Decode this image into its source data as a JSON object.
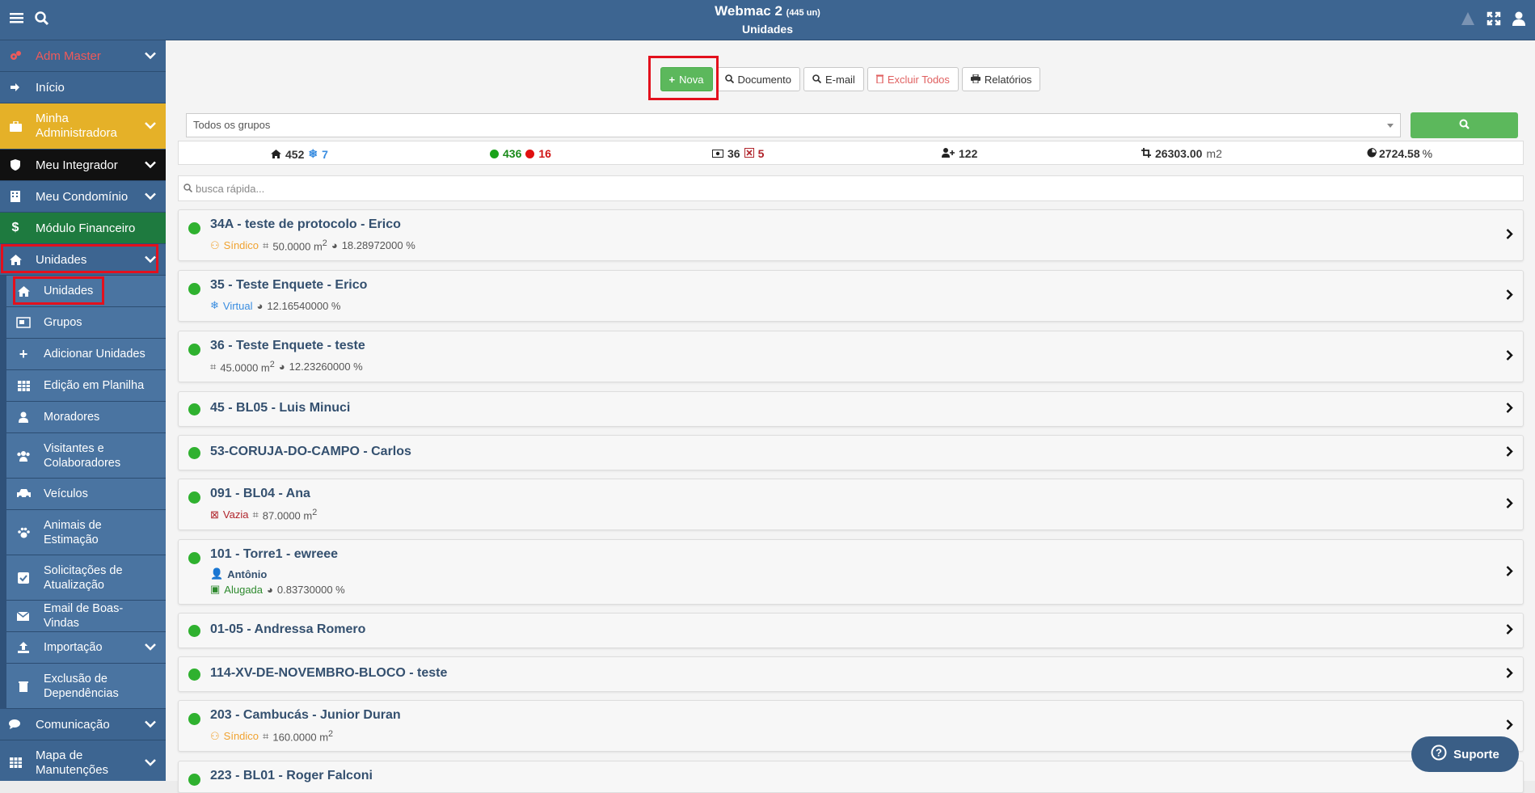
{
  "header": {
    "app_title": "Webmac 2",
    "count": "(445 un)",
    "subtitle": "Unidades",
    "menu_icon": "hamburger-icon",
    "search_icon": "search-icon"
  },
  "sidebar": {
    "admin": "Adm Master",
    "inicio": "Início",
    "minha": "Minha Administradora",
    "integrador": "Meu Integrador",
    "condominio": "Meu Condomínio",
    "financeiro": "Módulo Financeiro",
    "unidades": "Unidades",
    "sub": [
      "Unidades",
      "Grupos",
      "Adicionar Unidades",
      "Edição em Planilha",
      "Moradores",
      "Visitantes e Colaboradores",
      "Veículos",
      "Animais de Estimação",
      "Solicitações de Atualização",
      "Email de Boas-Vindas",
      "Importação",
      "Exclusão de Dependências"
    ],
    "comunicacao": "Comunicação",
    "mapa": "Mapa de Manutenções"
  },
  "toolbar": {
    "nova": "Nova",
    "documento": "Documento",
    "email": "E-mail",
    "excluir": "Excluir Todos",
    "relatorios": "Relatórios"
  },
  "filter": {
    "group_select": "Todos os grupos",
    "quick_placeholder": "busca rápida..."
  },
  "stats": {
    "total": "452",
    "virtual": "7",
    "active": "436",
    "inactive": "16",
    "vacant_a": "36",
    "vacant_b": "5",
    "residents": "122",
    "area": "26303.00",
    "area_unit": "m2",
    "fraction": "2724.58",
    "fraction_unit": "%"
  },
  "units": [
    {
      "name": "34A - teste de protocolo - Erico",
      "role": "Síndico",
      "area": "50.0000 m",
      "sup": "2",
      "fraction": "18.28972000 %"
    },
    {
      "name": "35 - Teste Enquete - Erico",
      "tag": "Virtual",
      "fraction": "12.16540000 %"
    },
    {
      "name": "36 - Teste Enquete - teste",
      "area": "45.0000 m",
      "sup": "2",
      "fraction": "12.23260000 %"
    },
    {
      "name": "45 - BL05 - Luis Minuci"
    },
    {
      "name": "53-CORUJA-DO-CAMPO - Carlos"
    },
    {
      "name": "091 - BL04 - Ana",
      "tag": "Vazia",
      "area": "87.0000 m",
      "sup": "2"
    },
    {
      "name": "101 - Torre1 - ewreee",
      "resident": "Antônio",
      "tag": "Alugada",
      "fraction": "0.83730000 %"
    },
    {
      "name": "01-05 - Andressa Romero"
    },
    {
      "name": "114-XV-DE-NOVEMBRO-BLOCO - teste"
    },
    {
      "name": "203 - Cambucás - Junior Duran",
      "role": "Síndico",
      "area": "160.0000 m",
      "sup": "2"
    },
    {
      "name": "223 - BL01 - Roger Falconi"
    }
  ],
  "support": "Suporte",
  "colors": {
    "topbar": "#3d6591",
    "green": "#5cb85c",
    "highlight": "#e3101d"
  }
}
